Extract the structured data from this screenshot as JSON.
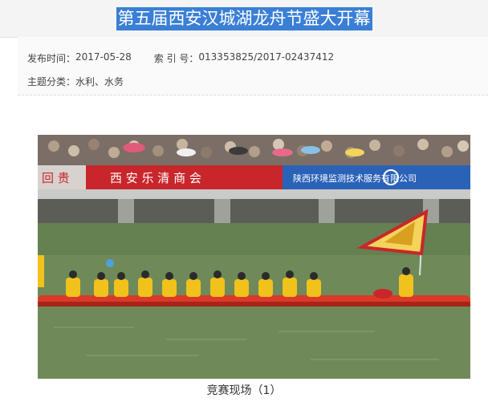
{
  "article": {
    "title": "第五届西安汉城湖龙舟节盛大开幕",
    "publish_label": "发布时间：",
    "publish_date": "2017-05-28",
    "index_label": "索 引 号：",
    "index_value": "013353825/2017-02437412",
    "topic_label": "主题分类：",
    "topic_value": "水利、水务"
  },
  "photo": {
    "banner_left_text": "西 安 乐 清 商 会",
    "banner_left_partial": "回 贵",
    "banner_right_text": "陕西环境监测技术服务有限公司",
    "caption": "竞赛现场（1）"
  },
  "colors": {
    "title_highlight": "#3a7fd5",
    "banner_red": "#c8262b",
    "banner_blue": "#2a62b8",
    "water": "#6f8a58",
    "boat_red": "#d93a2a"
  }
}
